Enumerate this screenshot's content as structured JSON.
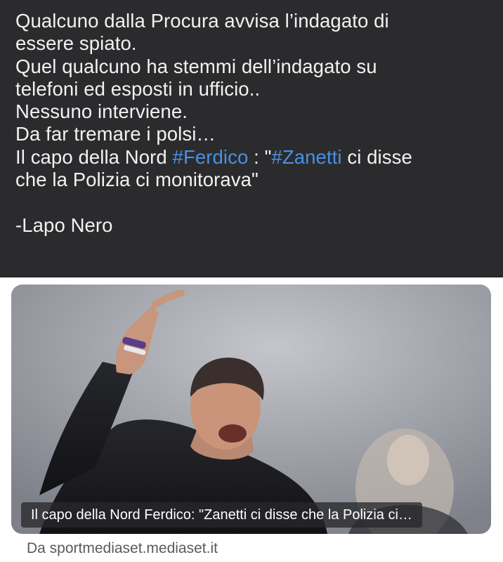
{
  "post": {
    "lines": [
      "Qualcuno dalla Procura avvisa l’indagato di",
      "essere spiato.",
      "Quel qualcuno ha stemmi dell’indagato su",
      "telefoni ed esposti in ufficio..",
      "Nessuno interviene.",
      "Da far tremare i polsi…"
    ],
    "quote_line1": {
      "prefix": "Il capo della Nord ",
      "hashtag1": "#Ferdico",
      "middle": " : \"",
      "hashtag2": "#Zanetti",
      "suffix": " ci disse"
    },
    "quote_line2": "che la Polizia ci monitorava\"",
    "signature": "-Lapo Nero"
  },
  "link_preview": {
    "caption": "Il capo della Nord Ferdico: \"Zanetti ci disse che la Polizia ci…",
    "source": "Da sportmediaset.mediaset.it"
  },
  "colors": {
    "background": "#2b2b2d",
    "text": "#f2f2f2",
    "hashtag": "#4a90e2",
    "source_text": "#5a5a5e"
  }
}
